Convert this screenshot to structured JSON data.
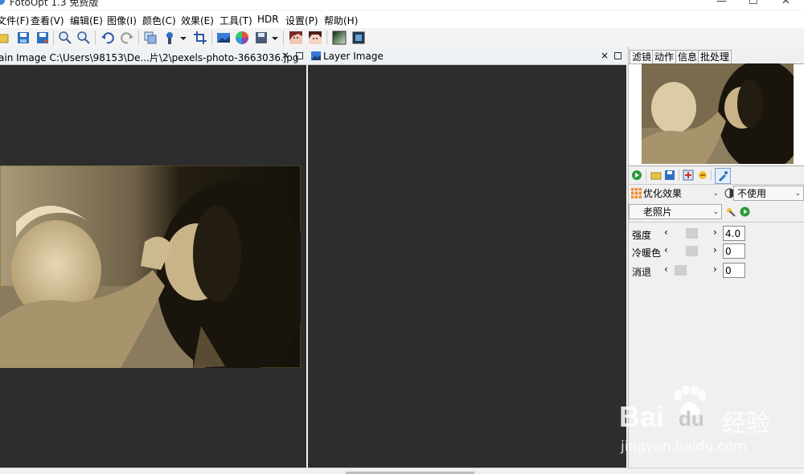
{
  "window": {
    "title": "FotoOpt 1.3 免费版"
  },
  "menu": [
    "文件(F)",
    "查看(V)",
    "编辑(E)",
    "图像(I)",
    "颜色(C)",
    "效果(E)",
    "工具(T)",
    "HDR",
    "设置(P)",
    "帮助(H)"
  ],
  "toolbar": {
    "icons": [
      "open-icon",
      "save-icon",
      "save-as-icon",
      "zoom-in-icon",
      "zoom-out-icon",
      "undo-icon",
      "redo-icon",
      "layer-icon",
      "brush-icon",
      "crop-icon",
      "landscape-icon",
      "color-wheel-icon",
      "save-disk-icon",
      "face-icon",
      "face-alt-icon",
      "gradient-icon",
      "image-icon"
    ]
  },
  "main_pane": {
    "title": "ain Image C:\\Users\\98153\\De...片\\2\\pexels-photo-3663036.jpg",
    "close": "×"
  },
  "layer_pane": {
    "title": "Layer Image",
    "close": "×"
  },
  "right_panel": {
    "tabs": [
      "滤镜",
      "动作",
      "信息",
      "批处理"
    ],
    "category": {
      "value": "优化效果",
      "arrow": "⌄"
    },
    "blend": {
      "value": "不使用",
      "arrow": "⌄"
    },
    "effect": {
      "value": "老照片",
      "arrow": "⌄"
    },
    "params": [
      {
        "label": "强度",
        "value": "4.0",
        "level": 0.45
      },
      {
        "label": "冷暖色",
        "value": "0",
        "level": 0.45
      },
      {
        "label": "消退",
        "value": "0",
        "level": 0.0
      }
    ]
  },
  "watermark": {
    "brand": "Bai",
    "brand2": "du",
    "cn": "经验",
    "url": "jingyan.baidu.com"
  },
  "colors": {
    "sepia_dark": "#1e1a10",
    "sepia_light": "#c8b794",
    "pane_bg": "#2d2d2d"
  }
}
